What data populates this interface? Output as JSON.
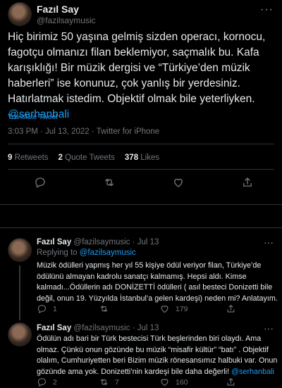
{
  "main_tweet": {
    "author_name": "Fazıl Say",
    "author_handle": "@fazilsaymusic",
    "text": "Hiç birimiz 50 yaşına gelmiş sizden operacı, kornocu, fagotçu olmanızı filan beklemiyor, saçmalık bu. Kafa karışıklığı! Bir müzik dergisi  ve  “Türkiye’den müzik haberleri” ise konunuz, çok yanlış bir yerdesiniz. Hatırlatmak istedim. Objektif olmak bile yeterliyken.",
    "mention": "@serhanbali",
    "translate_label": "Translate Tweet",
    "meta": "3:03 PM · Jul 13, 2022 · Twitter for iPhone",
    "retweets": {
      "count": "9",
      "label": "Retweets"
    },
    "quote_tweets": {
      "count": "2",
      "label": "Quote Tweets"
    },
    "likes": {
      "count": "378",
      "label": "Likes"
    },
    "more": "···"
  },
  "replies": [
    {
      "author_name": "Fazıl Say",
      "author_handle": "@fazilsaymusic",
      "date": "· Jul 13",
      "replying_prefix": "Replying to",
      "replying_to": "@fazilsaymusic",
      "text": "Müzik ödülleri yapmış her yıl 55 kişiye ödül veriyor filan, Türkiye’de ödülünü almayan kadrolu sanatçı kalmamış. Hepsi aldı. Kimse kalmadı...Ödüllerin adı DONİZETTİ ödülleri ( asıl besteci Donizetti bile değil, onun 19. Yüzyılda İstanbul’a gelen kardeşi) neden mi? Anlatayım.",
      "mention": "",
      "reply_count": "1",
      "retweet_count": "",
      "like_count": "179",
      "more": "···"
    },
    {
      "author_name": "Fazıl Say",
      "author_handle": "@fazilsaymusic",
      "date": "· Jul 13",
      "text": "Ödülün adı bari bir Türk bestecisi Türk beşlerinden biri olaydı. Ama olmaz. Çünkü onun gözünde bu müzik “misafir kültür” “batı” . Objektif olalım, Cumhuriyetten beri Bizim müzik rönesansımız halbuki var. Onun gözünde ama yok. Donizetti’nin kardeşi bile daha değerli!",
      "mention": "@serhanbali",
      "reply_count": "2",
      "retweet_count": "7",
      "like_count": "160",
      "more": "···"
    }
  ],
  "colors": {
    "background": "#000000",
    "text": "#e7e9ea",
    "muted": "#71767b",
    "link": "#1d9bf0",
    "divider": "#2f3336"
  },
  "icons": [
    "reply-icon",
    "retweet-icon",
    "like-icon",
    "share-icon",
    "more-icon"
  ]
}
